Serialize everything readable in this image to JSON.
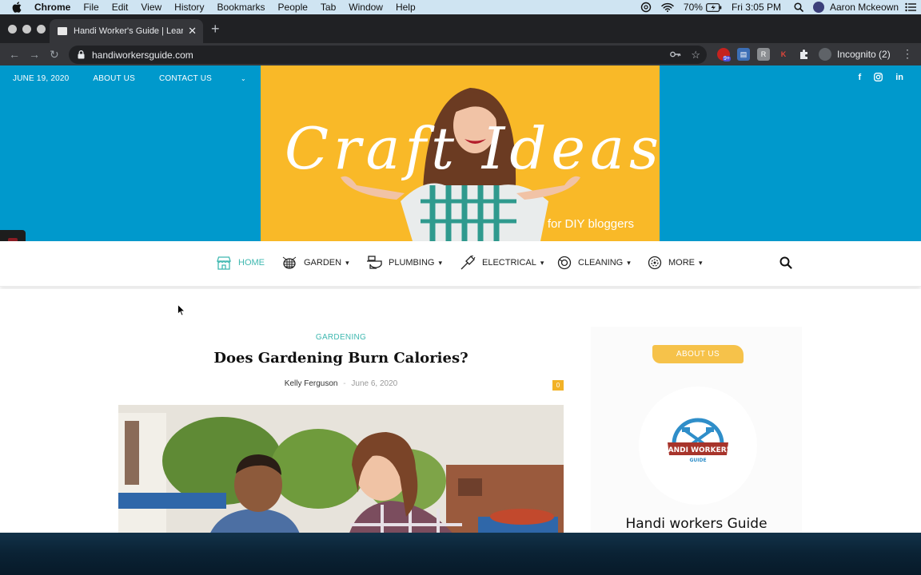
{
  "menubar": {
    "app": "Chrome",
    "items": [
      "File",
      "Edit",
      "View",
      "History",
      "Bookmarks",
      "People",
      "Tab",
      "Window",
      "Help"
    ],
    "battery": "70%",
    "clock": "Fri 3:05 PM",
    "user": "Aaron Mckeown"
  },
  "browser": {
    "tab_title": "Handi Worker's Guide | Learn h",
    "url": "handiworkersguide.com",
    "extension_badge": "9+",
    "extension_k": "K",
    "incognito_label": "Incognito (2)"
  },
  "site": {
    "topbar": {
      "date": "JUNE 19, 2020",
      "about": "ABOUT US",
      "contact": "CONTACT US"
    },
    "social": [
      "f",
      "ig",
      "in"
    ],
    "banner": {
      "title": "Craft Ideas",
      "subtitle": "for DIY bloggers"
    },
    "nav": [
      {
        "label": "HOME",
        "active": true
      },
      {
        "label": "GARDEN"
      },
      {
        "label": "PLUMBING"
      },
      {
        "label": "ELECTRICAL"
      },
      {
        "label": "CLEANING"
      },
      {
        "label": "MORE"
      }
    ],
    "post": {
      "category": "GARDENING",
      "title": "Does Gardening Burn Calories?",
      "author": "Kelly Ferguson",
      "date": "June 6, 2020",
      "comments": "0"
    },
    "sidebar": {
      "tag": "ABOUT US",
      "logo_text_1": "HANDI WORKER'S",
      "logo_text_2": "GUIDE",
      "name": "Handi workers Guide"
    }
  },
  "colors": {
    "header_blue": "#0099cc",
    "banner_yellow": "#f9b928",
    "accent_teal": "#3fb8b0",
    "tag_yellow": "#f6c24a"
  }
}
